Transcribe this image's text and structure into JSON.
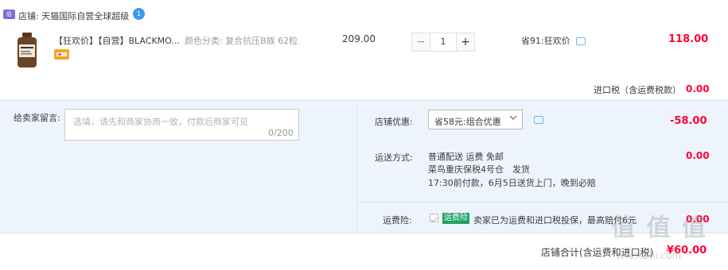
{
  "shop": {
    "label": "店铺: 天猫国际自营全球超级",
    "badge": "1"
  },
  "item": {
    "title": "【狂欢价】【自营】BLACKMO...",
    "spec": "颜色分类: 复合抗压B族 62粒",
    "unit_price": "209.00",
    "quantity": "1",
    "minus": "−",
    "plus": "+",
    "save_text": "省91:狂欢价",
    "total": "118.00"
  },
  "tax": {
    "label": "进口税（含运费税款）",
    "value": "0.00"
  },
  "message": {
    "label": "给卖家留言:",
    "placeholder": "选填，请先和商家协商一致，付款后商家可见",
    "count": "0/200"
  },
  "coupon": {
    "label": "店铺优惠:",
    "selected": "省58元:组合优惠",
    "value": "-58.00"
  },
  "shipping": {
    "label": "运送方式:",
    "line1": "普通配送 运费 免邮",
    "line2": "菜鸟重庆保税4号仓　发货",
    "line3": "17:30前付款，6月5日送货上门，晚到必赔",
    "value": "0.00"
  },
  "insurance": {
    "label": "运费险:",
    "badge": "运费险",
    "text": "卖家已为运费和进口税投保，最高赔付6元",
    "value": "0.00"
  },
  "summary": {
    "label": "店铺合计(含运费和进口税)",
    "value": "¥60.00"
  },
  "watermark": {
    "text": "值 值 值",
    "site": "zhizhizhi.com"
  },
  "colors": {
    "accent_red": "#ff0036",
    "panel_bg": "#eef4fc",
    "link_blue": "#3d9af0"
  }
}
